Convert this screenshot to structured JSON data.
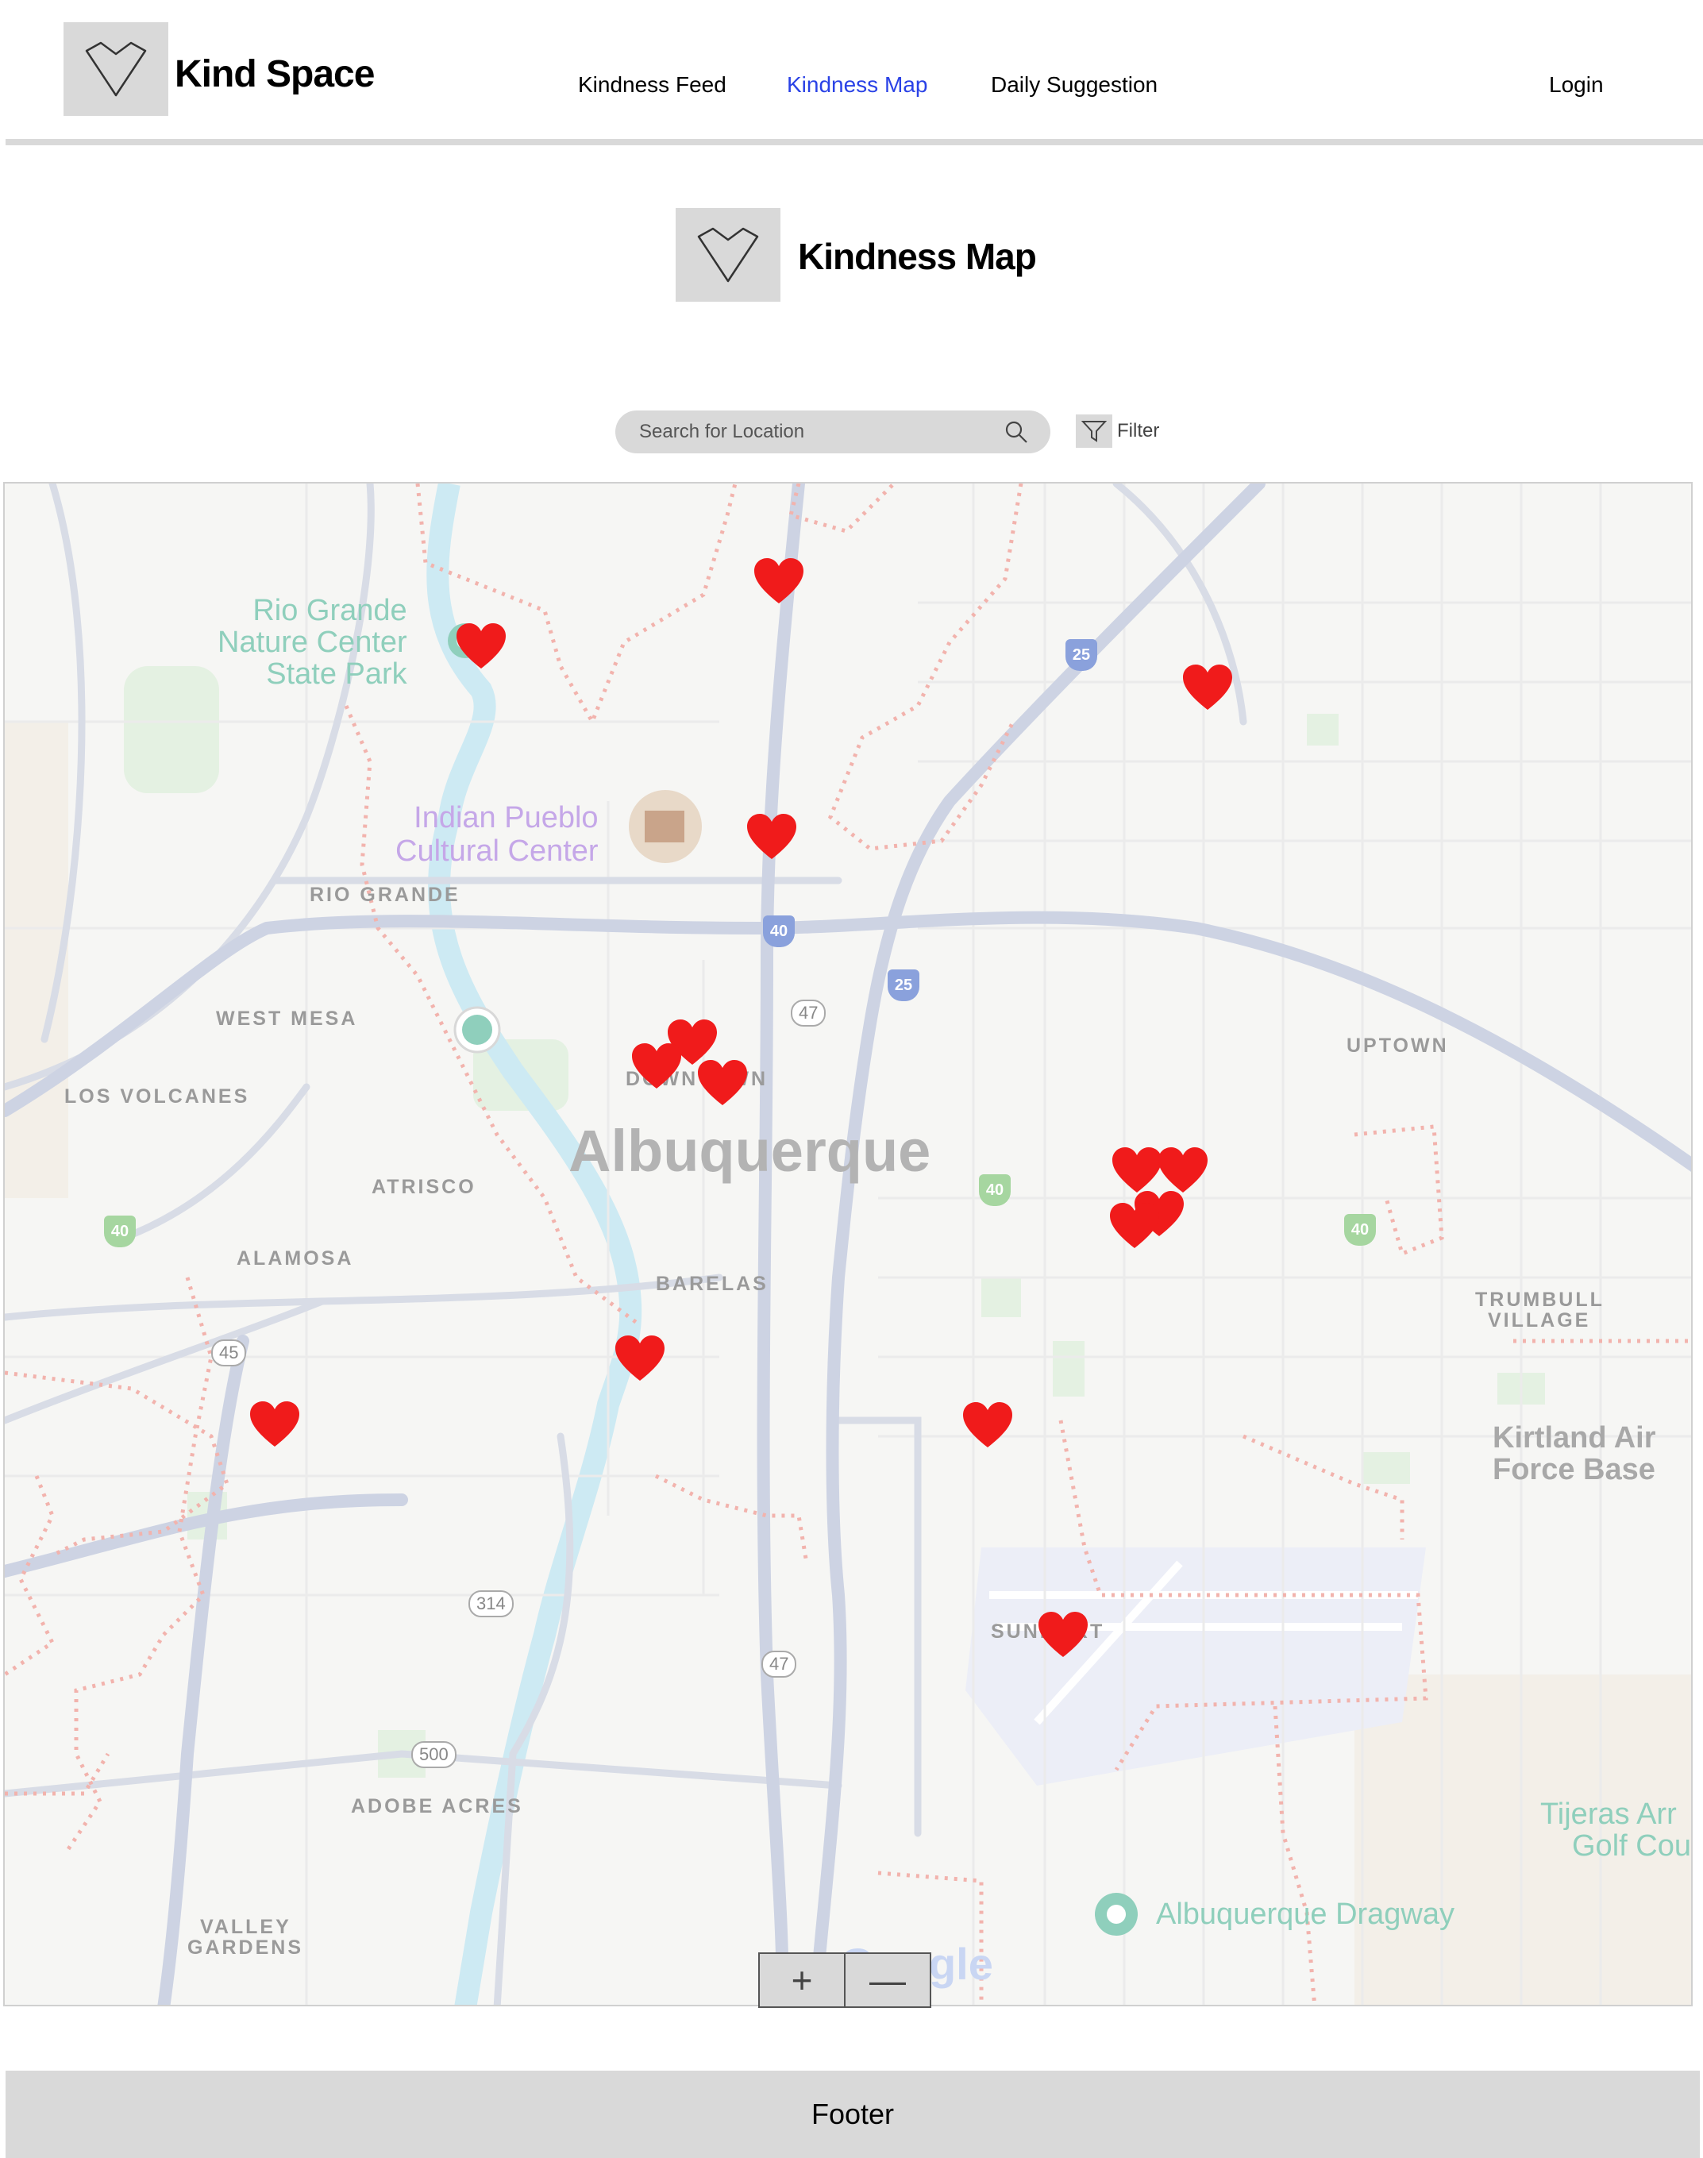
{
  "header": {
    "brand": "Kind Space",
    "nav": [
      {
        "label": "Kindness Feed"
      },
      {
        "label": "Kindness Map"
      },
      {
        "label": "Daily Suggestion"
      }
    ],
    "login": "Login",
    "active_color": "#2a42e6"
  },
  "page": {
    "title": "Kindness Map"
  },
  "search": {
    "placeholder": "Search for Location",
    "filter_label": "Filter"
  },
  "map": {
    "districts": [
      "RIO GRANDE",
      "WEST MESA",
      "LOS VOLCANES",
      "ATRISCO",
      "ALAMOSA",
      "BARELAS",
      "UPTOWN",
      "TRUMBULL",
      "VILLAGE",
      "ADOBE ACRES",
      "VALLEY",
      "GARDENS",
      "DOWNTOWN",
      "SUNPORT"
    ],
    "city": "Albuquerque",
    "poi": {
      "rio_grande_1": "Rio Grande",
      "rio_grande_2": "Nature Center",
      "rio_grande_3": "State Park",
      "pueblo_1": "Indian Pueblo",
      "pueblo_2": "Cultural Center",
      "kirtland_1": "Kirtland Air",
      "kirtland_2": "Force Base",
      "dragway": "Albuquerque Dragway",
      "tijeras_1": "Tijeras Arr",
      "tijeras_2": "Golf Cou"
    },
    "routes": {
      "i25": "25",
      "i40": "40",
      "r47": "47",
      "r45": "45",
      "r314": "314",
      "r500": "500"
    },
    "watermark": "Google",
    "heart_color": "#f01b1b",
    "marker_count": 17
  },
  "zoom": {
    "in": "+",
    "out": "—"
  },
  "footer": {
    "label": "Footer"
  }
}
